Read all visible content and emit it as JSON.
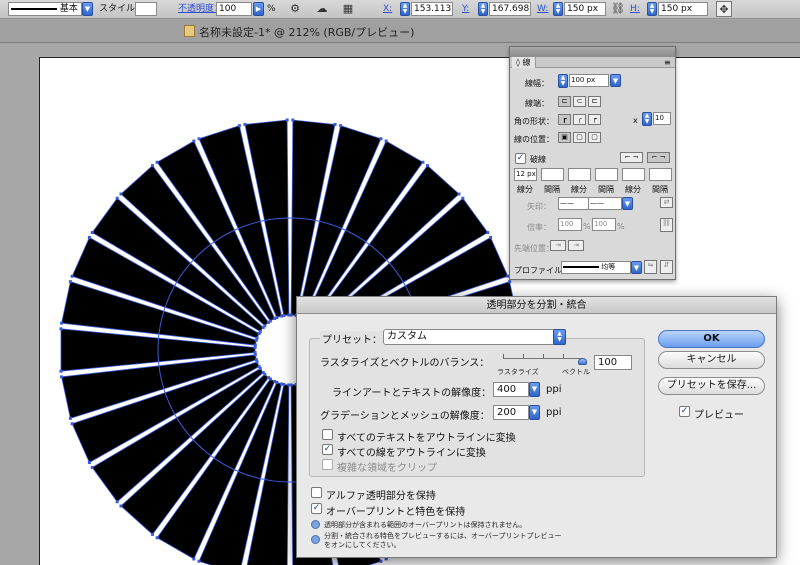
{
  "control_bar": {
    "stroke_profile": "基本",
    "style_label": "スタイル：",
    "opacity_label": "不透明度：",
    "opacity_value": "100",
    "opacity_unit": "%",
    "x_label": "X:",
    "x_value": "153.113 px",
    "y_label": "Y:",
    "y_value": "167.698 px",
    "w_label": "W:",
    "w_value": "150 px",
    "h_label": "H:",
    "h_value": "150 px"
  },
  "document_tab": {
    "title": "名称未設定-1* @ 212% (RGB/プレビュー)"
  },
  "stroke_panel": {
    "tab": "線",
    "weight_label": "線幅：",
    "weight_value": "100 px",
    "cap_label": "線端：",
    "corner_label": "角の形状：",
    "limit_prefix": "x",
    "limit_value": "10",
    "align_label": "線の位置：",
    "dashed_label": "破線",
    "dash_values": [
      "12 px",
      "",
      "",
      "",
      "",
      ""
    ],
    "dash_labels": [
      "線分",
      "間隔",
      "線分",
      "間隔",
      "線分",
      "間隔"
    ],
    "arrow_label": "矢印：",
    "scale_label": "倍率：",
    "scale_values": [
      "100",
      "100"
    ],
    "scale_unit": "%",
    "arrow_align_label": "先端位置：",
    "profile_label": "プロファイル：",
    "profile_value": "均等"
  },
  "dialog": {
    "title": "透明部分を分割・統合",
    "preset_label": "プリセット：",
    "preset_value": "カスタム",
    "balance_label": "ラスタライズとベクトルのバランス：",
    "balance_value": "100",
    "balance_left": "ラスタライズ",
    "balance_right": "ベクトル",
    "balance_fraction": 1.0,
    "line_art_label": "ラインアートとテキストの解像度：",
    "line_art_value": "400",
    "gradient_label": "グラデーションとメッシュの解像度：",
    "gradient_value": "200",
    "ppi": "ppi",
    "checks": [
      {
        "label": "すべてのテキストをアウトラインに変換",
        "checked": false,
        "disabled": false
      },
      {
        "label": "すべての線をアウトラインに変換",
        "checked": true,
        "disabled": false
      },
      {
        "label": "複雑な領域をクリップ",
        "checked": false,
        "disabled": true
      }
    ],
    "preserve_alpha": "アルファ透明部分を保持",
    "preserve_overprint": "オーバープリントと特色を保持",
    "info1": "透明部分が含まれる範囲のオーバープリントは保持されません。",
    "info2": "分割・統合される特色をプレビューするには、オーバープリントプレビューをオンにしてください。",
    "ok": "OK",
    "cancel": "キャンセル",
    "save_preset": "プリセットを保存...",
    "preview": "プレビュー"
  },
  "artwork": {
    "ray_count": 30,
    "ray_fill": "#000000",
    "path_color": "#3b5bdb"
  }
}
